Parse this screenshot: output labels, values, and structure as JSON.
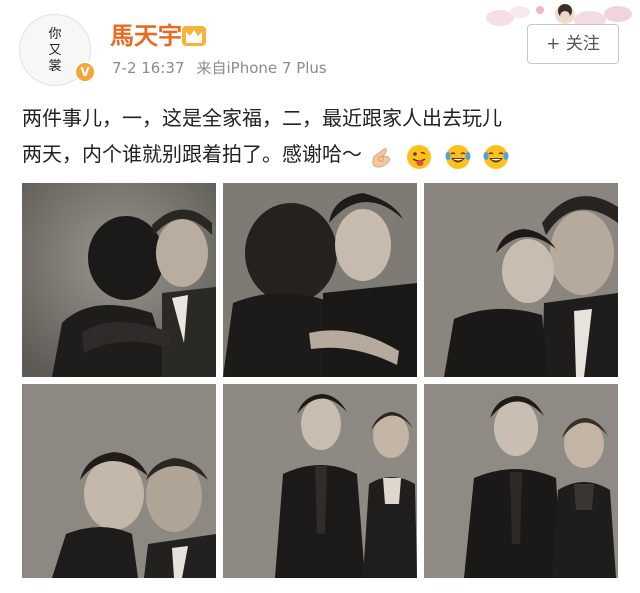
{
  "user": {
    "name": "馬天宇",
    "avatar_text": [
      "你",
      "又",
      "裳"
    ],
    "verified_badge": "V",
    "accent_color": "#e86b20"
  },
  "meta": {
    "time": "7-2 16:37",
    "source": "来自iPhone 7 Plus"
  },
  "follow_button": {
    "label": "+ 关注"
  },
  "post": {
    "line1": "两件事儿，一，这是全家福，二，最近跟家人出去玩儿",
    "line2": "两天，内个谁就别跟着拍了。感谢哈～",
    "emojis": [
      "ok-hand-icon",
      "tongue-face-icon",
      "laughing-tears-icon",
      "laughing-tears-icon"
    ]
  },
  "photos": [
    {
      "name": "photo-embrace-father",
      "tone": "sepia"
    },
    {
      "name": "photo-hug-smile",
      "tone": "sepia"
    },
    {
      "name": "photo-cheek-to-cheek",
      "tone": "sepia"
    },
    {
      "name": "photo-foreheads-touching",
      "tone": "sepia"
    },
    {
      "name": "photo-standing-with-mother",
      "tone": "sepia"
    },
    {
      "name": "photo-standing-with-mother-2",
      "tone": "sepia"
    }
  ]
}
